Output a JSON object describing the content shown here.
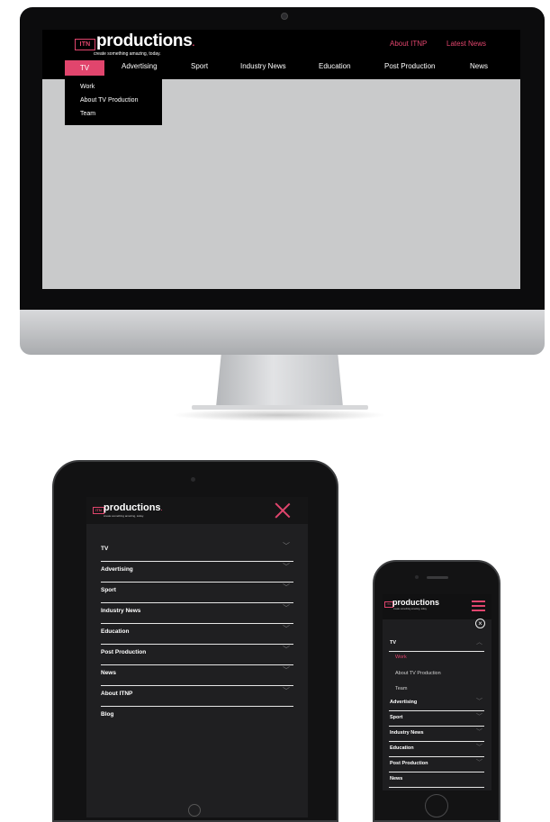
{
  "site": {
    "logo_badge": "ITN",
    "logo_word": "productions",
    "logo_dot": ".",
    "tagline": "create something amazing, today."
  },
  "desktop": {
    "top_links": [
      "About ITNP",
      "Latest News"
    ],
    "nav": [
      "TV",
      "Advertising",
      "Sport",
      "Industry News",
      "Education",
      "Post Production",
      "News"
    ],
    "active_nav": "TV",
    "dropdown": [
      "Work",
      "About TV Production",
      "Team"
    ]
  },
  "tablet": {
    "menu": [
      "TV",
      "Advertising",
      "Sport",
      "Industry News",
      "Education",
      "Post Production",
      "News",
      "About ITNP",
      "Blog"
    ]
  },
  "phone": {
    "expanded": "TV",
    "sub_items": [
      "Work",
      "About TV Production",
      "Team"
    ],
    "active_sub": "Work",
    "menu_after": [
      "Advertising",
      "Sport",
      "Industry News",
      "Education",
      "Post Production",
      "News"
    ]
  },
  "colors": {
    "accent": "#e1456d",
    "header_bg": "#000000",
    "screen_bg": "#c9cacb",
    "menu_bg": "#1f1f21"
  },
  "icons": {
    "dropdown_chevron": "chevron-down-icon",
    "expanded_chevron": "chevron-up-icon",
    "tablet_close": "close-icon",
    "phone_close": "close-circle-icon",
    "phone_menu": "hamburger-menu-icon"
  }
}
